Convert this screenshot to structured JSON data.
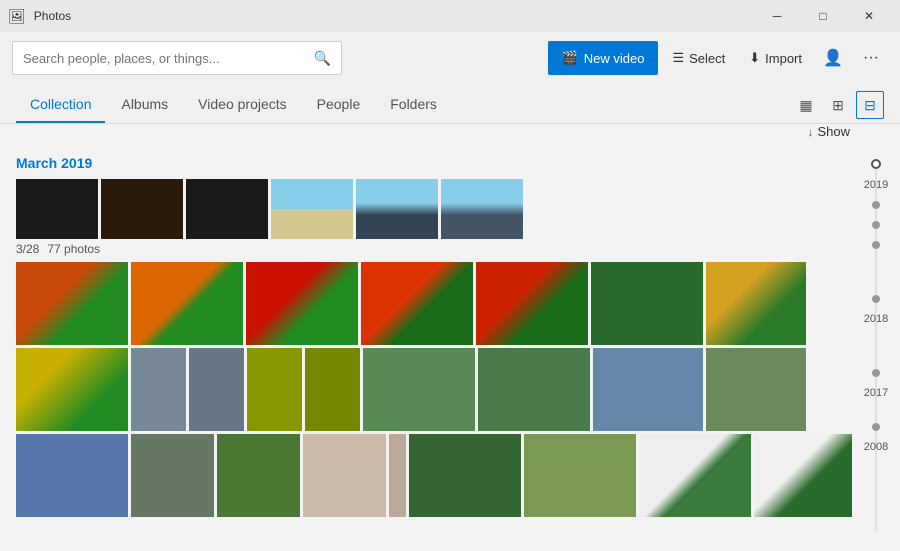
{
  "app": {
    "title": "Photos"
  },
  "titlebar": {
    "minimize_label": "─",
    "maximize_label": "□",
    "close_label": "✕"
  },
  "toolbar": {
    "search_placeholder": "Search people, places, or things...",
    "new_video_label": "New video",
    "select_label": "Select",
    "import_label": "Import",
    "more_label": "···"
  },
  "nav": {
    "tabs": [
      {
        "id": "collection",
        "label": "Collection",
        "active": true
      },
      {
        "id": "albums",
        "label": "Albums",
        "active": false
      },
      {
        "id": "video-projects",
        "label": "Video projects",
        "active": false
      },
      {
        "id": "people",
        "label": "People",
        "active": false
      },
      {
        "id": "folders",
        "label": "Folders",
        "active": false
      }
    ],
    "view_grid_label": "Grid view",
    "view_large_label": "Large grid",
    "view_detail_label": "Detail view",
    "show_label": "Show"
  },
  "content": {
    "section_date": "March 2019",
    "subheader_date": "3/28",
    "subheader_count": "77 photos"
  },
  "timeline": {
    "years": [
      "2019",
      "2018",
      "2017",
      "2008"
    ]
  }
}
